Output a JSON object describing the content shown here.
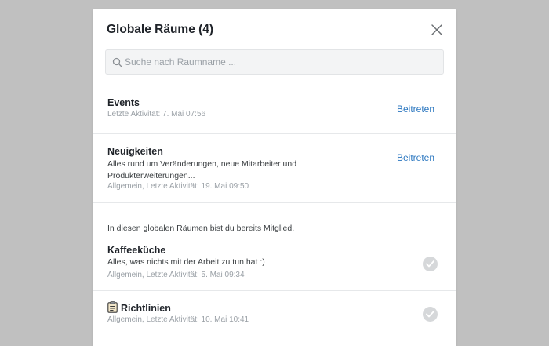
{
  "modal": {
    "title": "Globale Räume (4)",
    "close_icon": "close-icon"
  },
  "search": {
    "placeholder": "Suche nach Raumname ...",
    "value": "",
    "icon": "search-icon"
  },
  "available_rooms": [
    {
      "name": "Events",
      "description": "",
      "meta": "Letzte Aktivität: 7. Mai 07:56",
      "action": "Beitreten"
    },
    {
      "name": "Neuigkeiten",
      "description": "Alles rund um Veränderungen, neue Mitarbeiter und Produkterweiterungen...",
      "meta": "Allgemein, Letzte Aktivität: 19. Mai 09:50",
      "action": "Beitreten"
    }
  ],
  "member_note": "In diesen globalen Räumen bist du bereits Mitglied.",
  "member_rooms": [
    {
      "name": "Kaffeeküche",
      "description": "Alles, was nichts mit der Arbeit zu tun hat :)",
      "meta": "Allgemein, Letzte Aktivität: 5. Mai 09:34",
      "icon": "check-icon"
    },
    {
      "name": "Richtlinien",
      "prefix_icon": "document-icon",
      "meta": "Allgemein, Letzte Aktivität: 10. Mai 10:41",
      "icon": "check-icon"
    }
  ],
  "colors": {
    "overlay": "#c0c0c0",
    "accent_link": "#2b77c0",
    "check_badge": "#d6d8da"
  }
}
